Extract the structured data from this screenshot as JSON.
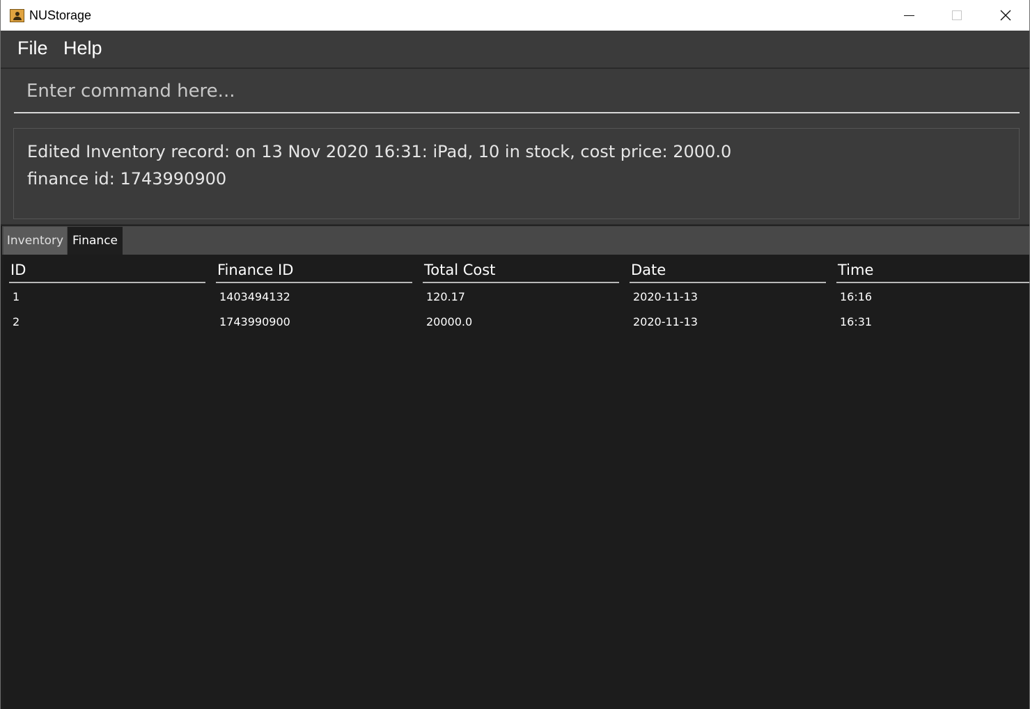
{
  "window": {
    "title": "NUStorage"
  },
  "menu": {
    "file": "File",
    "help": "Help"
  },
  "command": {
    "placeholder": "Enter command here...",
    "value": ""
  },
  "result": {
    "line1": "Edited Inventory record: on 13 Nov 2020 16:31: iPad, 10 in stock, cost price: 2000.0",
    "line2": "finance id: 1743990900"
  },
  "tabs": [
    {
      "label": "Inventory",
      "selected": false
    },
    {
      "label": "Finance",
      "selected": true
    }
  ],
  "table": {
    "columns": [
      "ID",
      "Finance ID",
      "Total Cost",
      "Date",
      "Time"
    ],
    "rows": [
      [
        "1",
        "1403494132",
        "120.17",
        "2020-11-13",
        "16:16"
      ],
      [
        "2",
        "1743990900",
        "20000.0",
        "2020-11-13",
        "16:31"
      ]
    ]
  },
  "icons": {
    "app": "app-user-icon",
    "minimize": "minimize-icon",
    "maximize": "maximize-icon",
    "close": "close-icon"
  },
  "colors": {
    "titlebar": "#ffffff",
    "panel": "#3b3b3b",
    "table_bg": "#1c1c1c",
    "tab_bar": "#484848",
    "text": "#ffffff"
  }
}
